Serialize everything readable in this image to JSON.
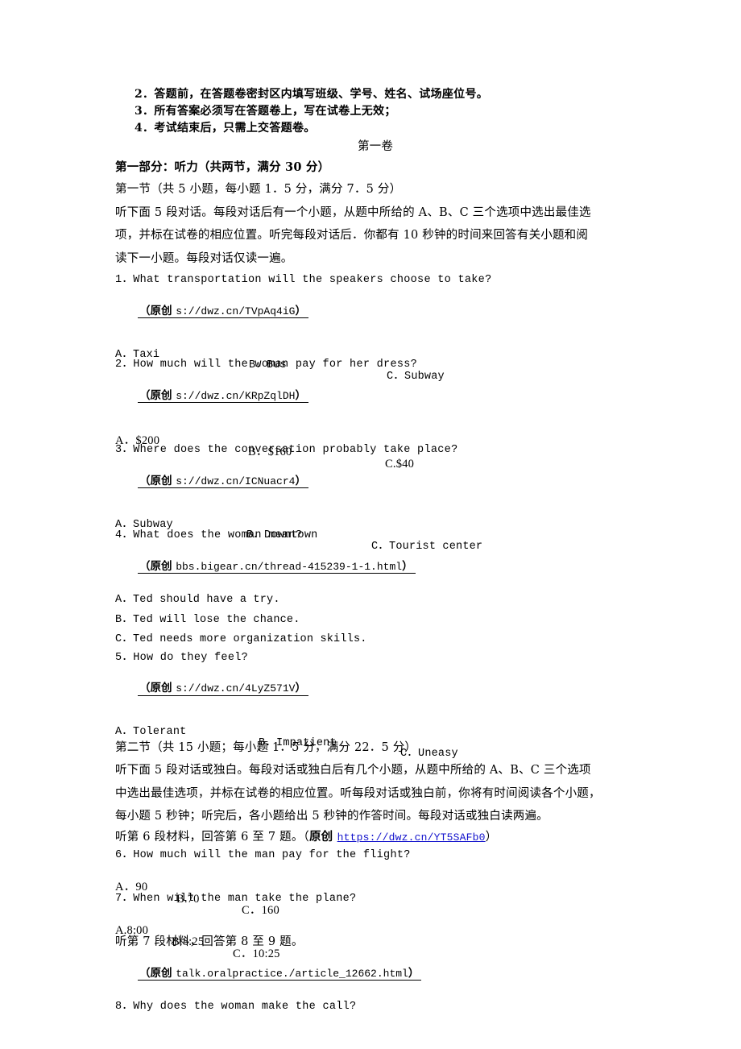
{
  "document": {
    "background_color": "#ffffff",
    "text_color": "#000000",
    "link_color": "#1111cc"
  },
  "instructions": [
    "2．答题前，在答题卷密封区内填写班级、学号、姓名、试场座位号。",
    "3．所有答案必须写在答题卷上，写在试卷上无效；",
    "4．考试结束后，只需上交答题卷。"
  ],
  "paper_title": "第一卷",
  "part_one": {
    "heading": "第一部分：听力（共两节，满分 30 分）",
    "section_one": {
      "heading": "第一节（共 5 小题，每小题 1．5 分，满分 7．5 分）",
      "instruction_lines": [
        "听下面 5 段对话。每段对话后有一个小题，从题中所给的 A、B、C 三个选项中选出最佳选",
        "项，并标在试卷的相应位置。听完每段对话后．你都有 10 秒钟的时间来回答有关小题和阅",
        "读下一小题。每段对话仅读一遍。"
      ],
      "questions": [
        {
          "number": "1．",
          "text": "What transportation will the speakers choose to take?",
          "annotation_prefix": "（原创 ",
          "annotation_url": "s://dwz.cn/TVpAq4iG",
          "annotation_suffix": "）",
          "options": [
            {
              "label": "A．",
              "value": "Taxi"
            },
            {
              "label": "B．",
              "value": "Bus"
            },
            {
              "label": "C．",
              "value": "Subway"
            }
          ]
        },
        {
          "number": "2．",
          "text": "How much will the woman pay for her dress?",
          "annotation_prefix": "（原创 ",
          "annotation_url": "s://dwz.cn/KRpZqlDH",
          "annotation_suffix": "）",
          "options": [
            {
              "label": "A．",
              "value": "$200"
            },
            {
              "label": "B．",
              "value": "$160"
            },
            {
              "label": "C.",
              "value": "$40"
            }
          ]
        },
        {
          "number": "3．",
          "text": "Where does the conversation probably take place?",
          "annotation_prefix": "（原创 ",
          "annotation_url": "s://dwz.cn/ICNuacr4",
          "annotation_suffix": "）",
          "options": [
            {
              "label": "A．",
              "value": "Subway"
            },
            {
              "label": "B．",
              "value": "Downtown"
            },
            {
              "label": "C．",
              "value": "Tourist center"
            }
          ]
        },
        {
          "number": "4．",
          "text": "What does the woman mean?",
          "annotation_prefix": "（原创 ",
          "annotation_url": "bbs.bigear.cn/thread-415239-1-1.html",
          "annotation_suffix": "）",
          "options_stacked": [
            "A．Ted should have a try.",
            "B．Ted will lose the chance.",
            "C．Ted needs more organization skills."
          ]
        },
        {
          "number": "5．",
          "text": "How do they feel?",
          "annotation_prefix": "（原创 ",
          "annotation_url": "s://dwz.cn/4LyZ571V",
          "annotation_suffix": "）",
          "options": [
            {
              "label": "A．",
              "value": "Tolerant"
            },
            {
              "label": "B．",
              "value": "Impatient"
            },
            {
              "label": "C．",
              "value": "Uneasy"
            }
          ]
        }
      ]
    },
    "section_two": {
      "heading": "第二节（共 15 小题；每小题 1．5 分，满分 22．5 分）",
      "instruction_lines": [
        "听下面 5 段对话或独白。每段对话或独白后有几个小题，从题中所给的 A、B、C 三个选项",
        "中选出最佳选项，并标在试卷的相应位置。听每段对话或独白前，你将有时间阅读各个小题，",
        "每小题 5 秒钟；听完后，各小题给出 5 秒钟的作答时间。每段对话或独白读两遍。"
      ],
      "material_six": {
        "text_prefix": "听第 6 段材料，回答第 6 至 7 题。（",
        "bold_label": "原创 ",
        "link": "https://dwz.cn/YT5SAFb0",
        "text_suffix": "）"
      },
      "questions": [
        {
          "number": "6．",
          "text": "How much will the man pay for the flight?",
          "options": [
            {
              "label": "A．",
              "value": "90"
            },
            {
              "label": "B.",
              "value": "70"
            },
            {
              "label": "C．",
              "value": "160"
            }
          ]
        },
        {
          "number": "7．",
          "text": "When will the man take the plane?",
          "options": [
            {
              "label": "A.",
              "value": "8:00"
            },
            {
              "label": "B.",
              "value": "8:25"
            },
            {
              "label": "C．",
              "value": "10:25"
            }
          ]
        }
      ],
      "material_seven": {
        "text": "听第 7 段材料，回答第 8 至 9 题。",
        "annotation_prefix": "（原创 ",
        "annotation_url": "talk.oralpractice./article_12662.html",
        "annotation_suffix": "）"
      },
      "question_eight": {
        "number": "8．",
        "text": "Why does the woman make the call?"
      }
    }
  }
}
